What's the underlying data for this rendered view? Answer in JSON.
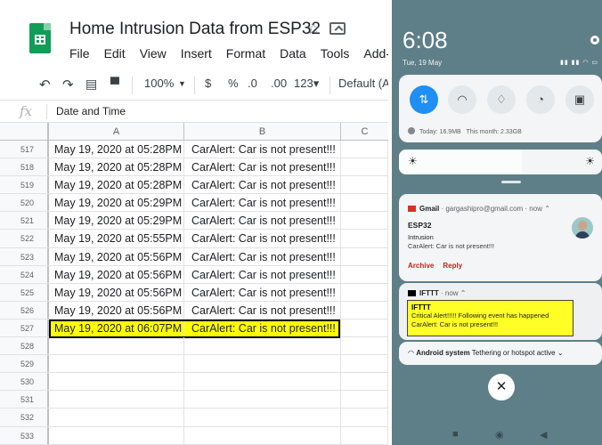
{
  "sheet": {
    "title": "Home Intrusion Data from ESP32",
    "menu": [
      "File",
      "Edit",
      "View",
      "Insert",
      "Format",
      "Data",
      "Tools",
      "Add-ons"
    ],
    "toolbar": {
      "zoom": "100%",
      "currency": "$",
      "percent": "%",
      "decrease_decimal": ".0",
      "increase_decimal": ".00",
      "more_formats": "123▾",
      "font": "Default (Ari"
    },
    "formula_value": "Date and Time",
    "columns": [
      "A",
      "B",
      "C"
    ],
    "rows": [
      {
        "n": "517",
        "a": "May 19, 2020 at 05:28PM",
        "b": "CarAlert: Car is not present!!!"
      },
      {
        "n": "518",
        "a": "May 19, 2020 at 05:28PM",
        "b": "CarAlert: Car is not present!!!"
      },
      {
        "n": "519",
        "a": "May 19, 2020 at 05:28PM",
        "b": "CarAlert: Car is not present!!!"
      },
      {
        "n": "520",
        "a": "May 19, 2020 at 05:29PM",
        "b": "CarAlert: Car is not present!!!"
      },
      {
        "n": "521",
        "a": "May 19, 2020 at 05:29PM",
        "b": "CarAlert: Car is not present!!!"
      },
      {
        "n": "522",
        "a": "May 19, 2020 at 05:55PM",
        "b": "CarAlert: Car is not present!!!"
      },
      {
        "n": "523",
        "a": "May 19, 2020 at 05:56PM",
        "b": "CarAlert: Car is not present!!!"
      },
      {
        "n": "524",
        "a": "May 19, 2020 at 05:56PM",
        "b": "CarAlert: Car is not present!!!"
      },
      {
        "n": "525",
        "a": "May 19, 2020 at 05:56PM",
        "b": "CarAlert: Car is not present!!!"
      },
      {
        "n": "526",
        "a": "May 19, 2020 at 05:56PM",
        "b": "CarAlert: Car is not present!!!"
      },
      {
        "n": "527",
        "a": "May 19, 2020 at 06:07PM",
        "b": "CarAlert: Car is not present!!!",
        "highlight": true
      },
      {
        "n": "528",
        "a": "",
        "b": ""
      },
      {
        "n": "529",
        "a": "",
        "b": ""
      },
      {
        "n": "530",
        "a": "",
        "b": ""
      },
      {
        "n": "531",
        "a": "",
        "b": ""
      },
      {
        "n": "532",
        "a": "",
        "b": ""
      },
      {
        "n": "533",
        "a": "",
        "b": ""
      }
    ],
    "highlight_color": "#ffff00"
  },
  "phone": {
    "time": "6:08",
    "date": "Tue, 19 May",
    "data_usage": {
      "today": "Today: 16.9MB",
      "month": "This month: 2.33GB"
    },
    "gmail": {
      "app": "Gmail",
      "account": "· gargashipro@gmail.com · now ⌃",
      "title": "ESP32",
      "line1": "Intrusion",
      "line2": "CarAlert: Car is not present!!!",
      "actions": [
        "Archive",
        "Reply"
      ]
    },
    "ifttt": {
      "app": "IFTTT",
      "meta": "· now ⌃",
      "title": "IFTTT",
      "line1": "Critical Alert!!!!! Following event has happened",
      "line2": "CarAlert: Car is not present!!!"
    },
    "android": {
      "title": "Android system",
      "text": "Tethering or hotspot active ⌄"
    },
    "colors": {
      "accent": "#1f8ff5",
      "shade_bg": "#5f7f88",
      "highlight": "#ffff26"
    }
  }
}
